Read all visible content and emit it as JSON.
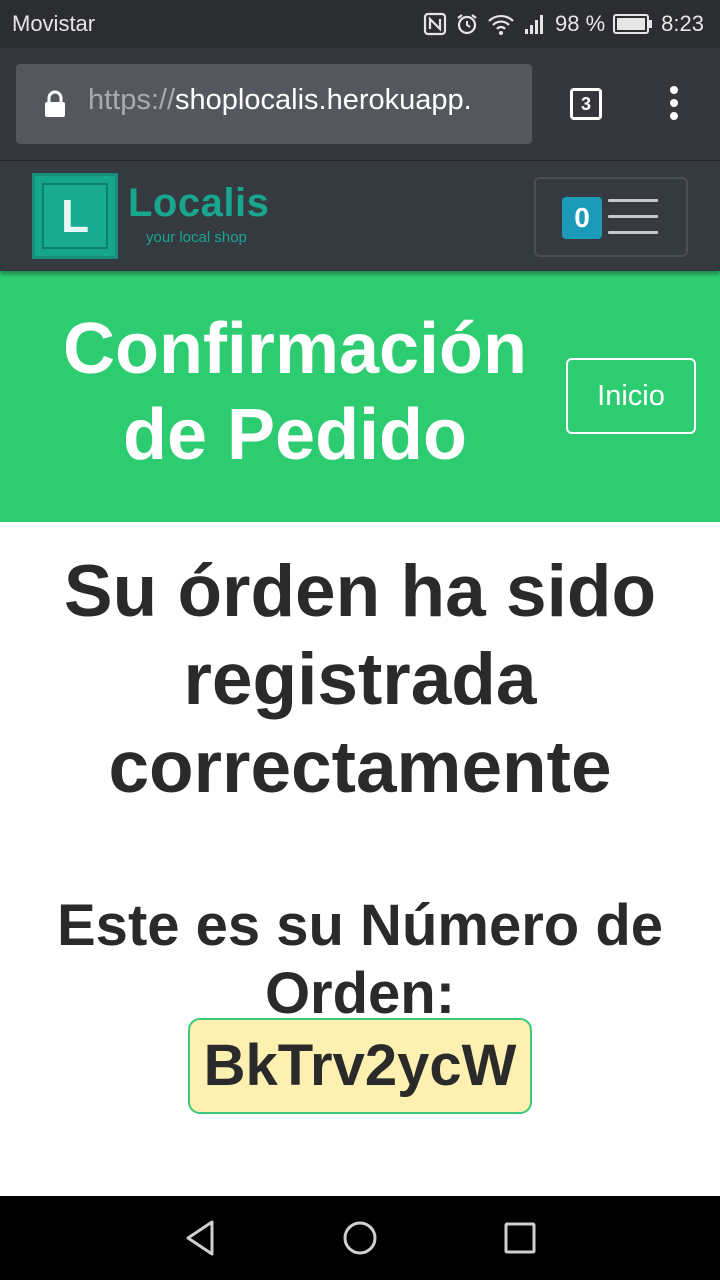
{
  "status_bar": {
    "carrier": "Movistar",
    "battery": "98 %",
    "time": "8:23",
    "icons": [
      "nfc-icon",
      "alarm-icon",
      "wifi-icon",
      "signal-icon",
      "battery-icon"
    ]
  },
  "browser": {
    "url_scheme": "https://",
    "url_host": "shoplocalis.herokuapp.",
    "tab_count": "3",
    "icons": [
      "lock-icon",
      "more-vert-icon"
    ]
  },
  "header": {
    "logo_letter": "L",
    "brand_name": "Localis",
    "tagline": "your local shop",
    "cart_count": "0",
    "icons": [
      "hamburger-menu-icon"
    ]
  },
  "banner": {
    "title": "Confirmación de Pedido",
    "inicio_label": "Inicio"
  },
  "main": {
    "heading": "Su órden ha sido registrada correctamente",
    "order_label": "Este es su Número de Orden:",
    "order_number": "BkTrv2ycW"
  },
  "nav_bar": {
    "icons": [
      "back-triangle-icon",
      "home-circle-icon",
      "recents-square-icon"
    ]
  },
  "colors": {
    "banner_green": "#2ecc71",
    "brand_teal": "#19a68f",
    "badge_blue": "#1b9bb8",
    "order_highlight": "#fdf0b0",
    "header_dark": "#353940"
  }
}
